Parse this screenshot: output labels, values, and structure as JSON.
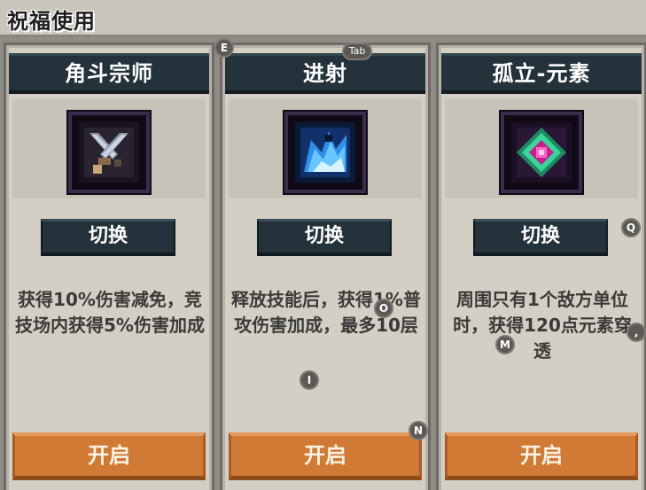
{
  "header": {
    "title": "祝福使用"
  },
  "cards": [
    {
      "name": "角斗宗师",
      "switch_label": "切换",
      "description": "获得10%伤害减免，竞技场内获得5%伤害加成",
      "open_label": "开启",
      "icon": "crossed-swords-icon",
      "frame_color": "#3b2c4d"
    },
    {
      "name": "进射",
      "switch_label": "切换",
      "description": "释放技能后，获得1%普攻伤害加成，最多10层",
      "open_label": "开启",
      "icon": "blue-splash-icon",
      "frame_color": "#3b2c4d"
    },
    {
      "name": "孤立-元素",
      "switch_label": "切换",
      "description": "周围只有1个敌方单位时，获得120点元素穿透",
      "open_label": "开启",
      "icon": "green-crystal-icon",
      "frame_color": "#3b2c4d"
    }
  ],
  "key_hints": {
    "e": "E",
    "tab": "Tab",
    "q": "Q",
    "o": "O",
    "i": "I",
    "m": "M",
    "n": "N",
    "comma": ","
  },
  "colors": {
    "header_dark": "#24333b",
    "open_button": "#d07a35",
    "panel_bg": "#d3cfc5"
  }
}
